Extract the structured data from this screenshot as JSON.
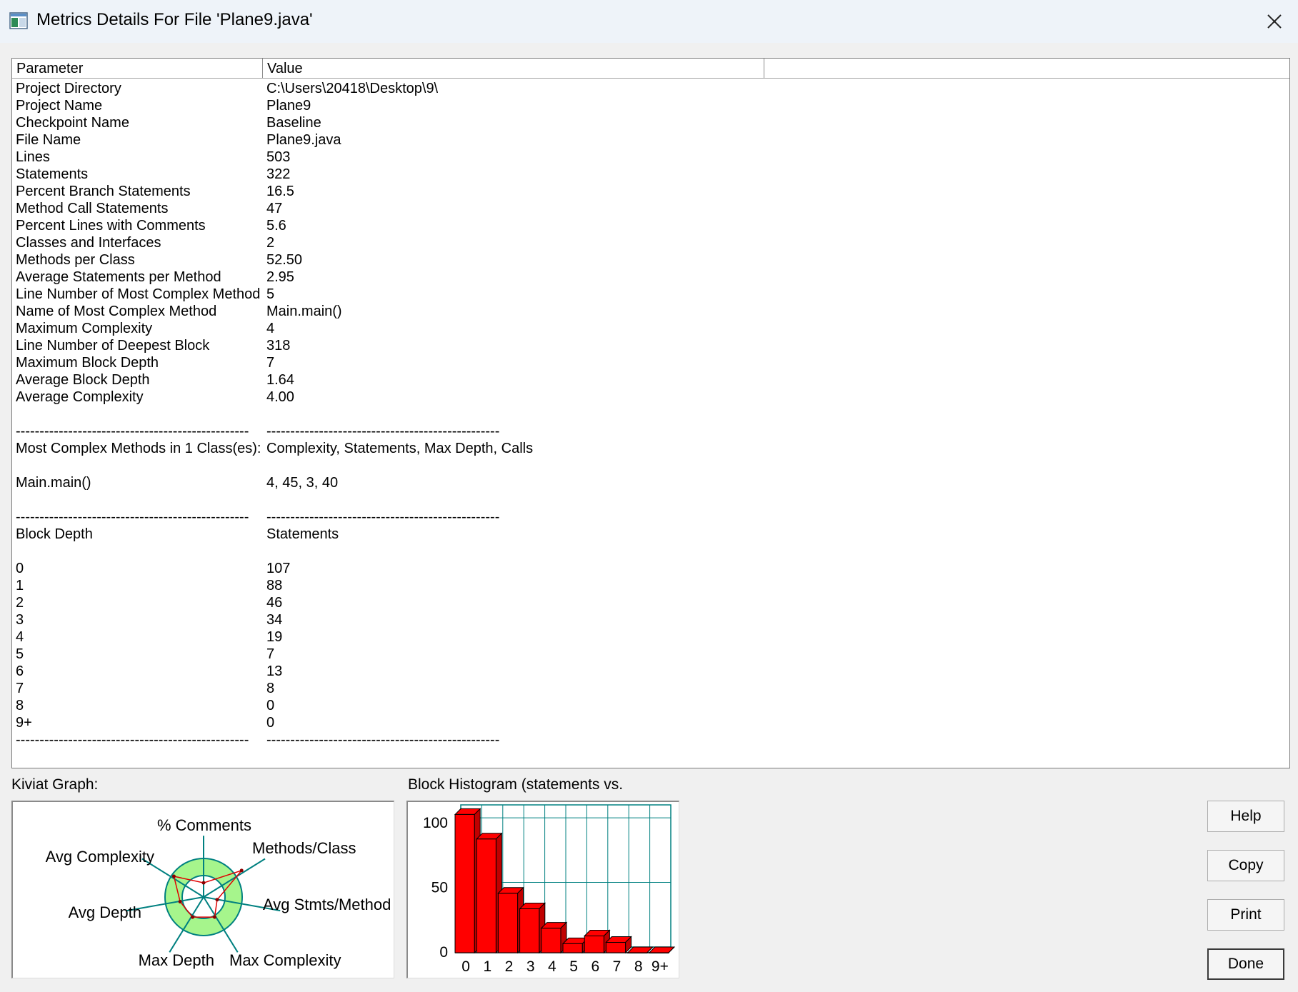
{
  "window": {
    "title": "Metrics Details For File 'Plane9.java'",
    "icon": "app-window-icon",
    "close_icon": "close-icon"
  },
  "grid": {
    "columns": [
      "Parameter",
      "Value",
      ""
    ],
    "rows": [
      [
        "Project Directory",
        "C:\\Users\\20418\\Desktop\\9\\"
      ],
      [
        "Project Name",
        "Plane9"
      ],
      [
        "Checkpoint Name",
        "Baseline"
      ],
      [
        "File Name",
        "Plane9.java"
      ],
      [
        "Lines",
        "503"
      ],
      [
        "Statements",
        "322"
      ],
      [
        "Percent Branch Statements",
        "16.5"
      ],
      [
        "Method Call Statements",
        "47"
      ],
      [
        "Percent Lines with Comments",
        "5.6"
      ],
      [
        "Classes and Interfaces",
        "2"
      ],
      [
        "Methods per Class",
        "52.50"
      ],
      [
        "Average Statements per Method",
        "2.95"
      ],
      [
        "Line Number of Most Complex Method",
        "5"
      ],
      [
        "Name of Most Complex Method",
        "Main.main()"
      ],
      [
        "Maximum Complexity",
        "4"
      ],
      [
        "Line Number of Deepest Block",
        "318"
      ],
      [
        "Maximum Block Depth",
        "7"
      ],
      [
        "Average Block Depth",
        "1.64"
      ],
      [
        "Average Complexity",
        "4.00"
      ],
      [
        "",
        ""
      ],
      [
        "-------------------------------------------------",
        "-------------------------------------------------"
      ],
      [
        "Most Complex Methods in 1 Class(es):",
        "Complexity, Statements, Max Depth, Calls"
      ],
      [
        "",
        ""
      ],
      [
        "Main.main()",
        "4, 45, 3, 40"
      ],
      [
        "",
        ""
      ],
      [
        "-------------------------------------------------",
        "-------------------------------------------------"
      ],
      [
        "Block Depth",
        "Statements"
      ],
      [
        "",
        ""
      ],
      [
        "0",
        "107"
      ],
      [
        "1",
        "88"
      ],
      [
        "2",
        "46"
      ],
      [
        "3",
        "34"
      ],
      [
        "4",
        "19"
      ],
      [
        "5",
        "7"
      ],
      [
        "6",
        "13"
      ],
      [
        "7",
        "8"
      ],
      [
        "8",
        "0"
      ],
      [
        "9+",
        "0"
      ],
      [
        "-------------------------------------------------",
        "-------------------------------------------------"
      ]
    ]
  },
  "kiviat": {
    "label": "Kiviat Graph:",
    "axes": [
      "% Comments",
      "Methods/Class",
      "Avg Stmts/Method",
      "Max Complexity",
      "Max Depth",
      "Avg Depth",
      "Avg Complexity"
    ],
    "ring_color": "#a6f58c",
    "axis_color": "#008080",
    "polygon_color": "#e00000"
  },
  "histogram": {
    "label": "Block Histogram (statements vs.",
    "bar_color": "#ff0000"
  },
  "chart_data": {
    "type": "bar",
    "categories": [
      "0",
      "1",
      "2",
      "3",
      "4",
      "5",
      "6",
      "7",
      "8",
      "9+"
    ],
    "values": [
      107,
      88,
      46,
      34,
      19,
      7,
      13,
      8,
      0,
      0
    ],
    "yticks": [
      "100",
      "50",
      "0"
    ],
    "ylim": [
      0,
      110
    ],
    "grid": true
  },
  "buttons": {
    "help": "Help",
    "copy": "Copy",
    "print": "Print",
    "done": "Done"
  }
}
